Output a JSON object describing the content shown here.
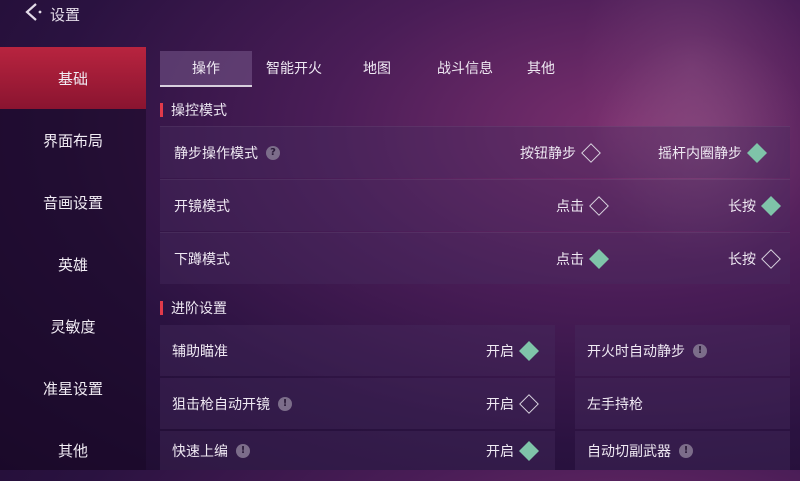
{
  "header": {
    "back_label": "设置"
  },
  "sidebar": {
    "items": [
      {
        "label": "基础",
        "active": true
      },
      {
        "label": "界面布局"
      },
      {
        "label": "音画设置"
      },
      {
        "label": "英雄"
      },
      {
        "label": "灵敏度"
      },
      {
        "label": "准星设置"
      },
      {
        "label": "其他"
      }
    ]
  },
  "tabs": [
    {
      "label": "操作",
      "active": true
    },
    {
      "label": "智能开火"
    },
    {
      "label": "地图"
    },
    {
      "label": "战斗信息"
    },
    {
      "label": "其他"
    }
  ],
  "sections": {
    "control": {
      "title": "操控模式",
      "rows": [
        {
          "label": "静步操作模式",
          "has_info": true,
          "opt1": "按钮静步",
          "opt1_checked": false,
          "opt2": "摇杆内圈静步",
          "opt2_checked": true
        },
        {
          "label": "开镜模式",
          "opt1": "点击",
          "opt1_checked": false,
          "opt2": "长按",
          "opt2_checked": true
        },
        {
          "label": "下蹲模式",
          "opt1": "点击",
          "opt1_checked": true,
          "opt2": "长按",
          "opt2_checked": false
        }
      ]
    },
    "advanced": {
      "title": "进阶设置",
      "left": [
        {
          "label": "辅助瞄准",
          "value": "开启",
          "checked": true
        },
        {
          "label": "狙击枪自动开镜",
          "has_info": true,
          "value": "开启",
          "checked": false
        },
        {
          "label": "快速上编",
          "has_info": true,
          "value": "开启",
          "checked": true
        }
      ],
      "right": [
        {
          "label": "开火时自动静步",
          "has_info": true
        },
        {
          "label": "左手持枪"
        },
        {
          "label": "自动切副武器",
          "has_info": true
        }
      ]
    }
  },
  "colors": {
    "accent_red": "#b8243f",
    "check_green": "#7fc4a9"
  },
  "icons": {
    "back": "chevron-left-icon",
    "info": "info-icon",
    "radio": "diamond-radio-icon"
  }
}
